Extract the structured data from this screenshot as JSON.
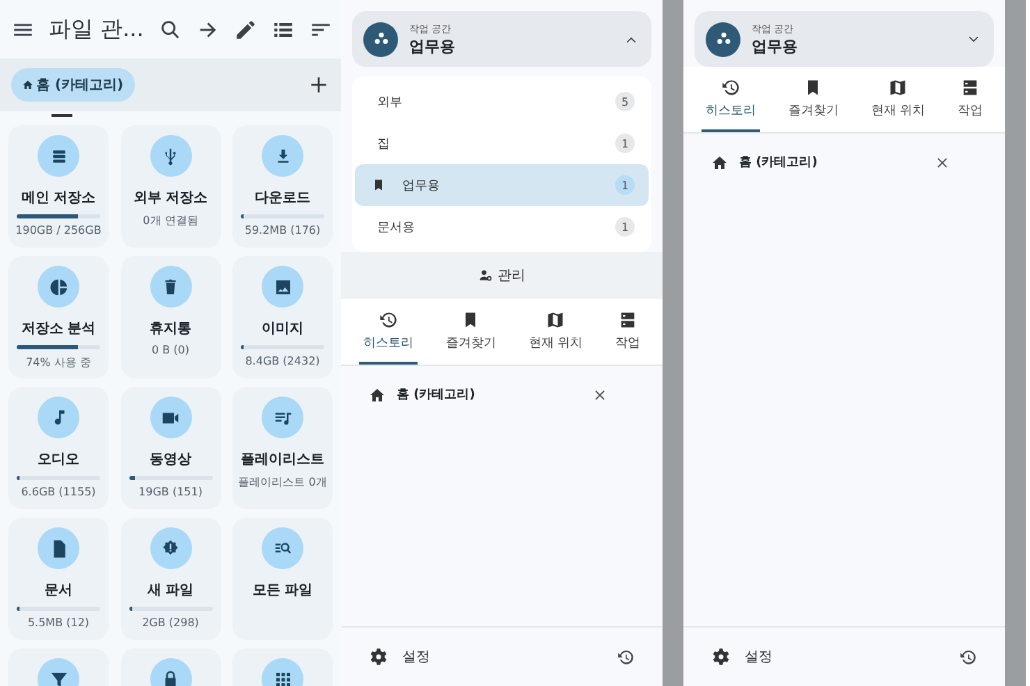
{
  "file_manager": {
    "title": "파일 관...",
    "tabs": [
      {
        "label": "홈 (카테고리)",
        "selected": true
      }
    ],
    "tiles": [
      {
        "kind": "storage",
        "name": "메인 저장소",
        "level": 0.74,
        "info": "190GB / 256GB"
      },
      {
        "kind": "usb",
        "name": "외부 저장소",
        "info": "0개 연결됨"
      },
      {
        "kind": "download",
        "name": "다운로드",
        "level": 0.02,
        "info": "59.2MB (176)"
      },
      {
        "kind": "pie",
        "name": "저장소 분석",
        "level": 0.74,
        "info": "74% 사용 중"
      },
      {
        "kind": "trash",
        "name": "휴지통",
        "info": "0 B (0)"
      },
      {
        "kind": "image",
        "name": "이미지",
        "level": 0.03,
        "info": "8.4GB (2432)"
      },
      {
        "kind": "music",
        "name": "오디오",
        "level": 0.03,
        "info": "6.6GB (1155)"
      },
      {
        "kind": "video",
        "name": "동영상",
        "level": 0.07,
        "info": "19GB (151)"
      },
      {
        "kind": "playlist",
        "name": "플레이리스트",
        "info": "플레이리스트 0개"
      },
      {
        "kind": "doc",
        "name": "문서",
        "level": 0.02,
        "info": "5.5MB (12)"
      },
      {
        "kind": "new",
        "name": "새 파일",
        "level": 0.02,
        "info": "2GB (298)"
      },
      {
        "kind": "search",
        "name": "모든 파일"
      },
      {
        "kind": "filter"
      },
      {
        "kind": "lock"
      },
      {
        "kind": "grid"
      }
    ]
  },
  "drawers": [
    {
      "workspace": {
        "caption": "작업 공간",
        "name": "업무용",
        "expanded": true
      },
      "workspace_list": [
        {
          "name": "외부",
          "count": "5",
          "selected": false
        },
        {
          "name": "집",
          "count": "1",
          "selected": false
        },
        {
          "name": "업무용",
          "count": "1",
          "selected": true
        },
        {
          "name": "문서용",
          "count": "1",
          "selected": false
        }
      ],
      "manage_button": "관리",
      "tabs": [
        {
          "kind": "history",
          "label": "히스토리",
          "selected": true
        },
        {
          "kind": "bookmark",
          "label": "즐겨찾기",
          "selected": false
        },
        {
          "kind": "map",
          "label": "현재 위치",
          "selected": false
        },
        {
          "kind": "tasks",
          "label": "작업",
          "selected": false
        }
      ],
      "history": [
        {
          "label": "홈 (카테고리)"
        }
      ],
      "settings": "설정"
    },
    {
      "workspace": {
        "caption": "작업 공간",
        "name": "업무용",
        "expanded": false
      },
      "tabs": [
        {
          "kind": "history",
          "label": "히스토리",
          "selected": true
        },
        {
          "kind": "bookmark",
          "label": "즐겨찾기",
          "selected": false
        },
        {
          "kind": "map",
          "label": "현재 위치",
          "selected": false
        },
        {
          "kind": "tasks",
          "label": "작업",
          "selected": false
        }
      ],
      "history": [
        {
          "label": "홈 (카테고리)"
        }
      ],
      "settings": "설정"
    }
  ]
}
